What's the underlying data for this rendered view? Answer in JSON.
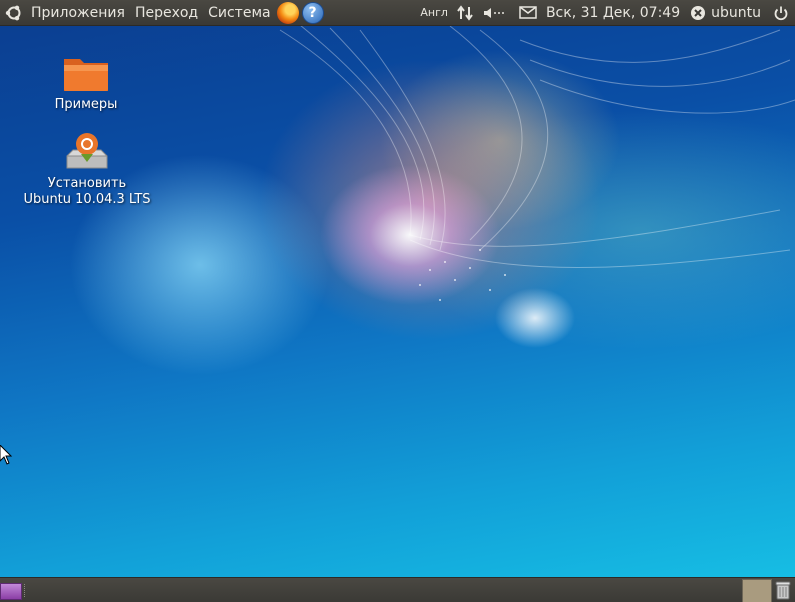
{
  "top_panel": {
    "menus": {
      "applications": "Приложения",
      "places": "Переход",
      "system": "Система"
    },
    "launchers": {
      "firefox": "firefox-icon",
      "help": "help-icon",
      "help_glyph": "?"
    },
    "keyboard_layout": "Англ",
    "network_icon": "network-arrows-icon",
    "volume_icon": "volume-icon",
    "mail_icon": "mail-icon",
    "clock": "Вск, 31 Дек, 07:49",
    "user_name": "ubuntu",
    "power_icon": "power-icon"
  },
  "desktop": {
    "icons": [
      {
        "label": "Примеры",
        "icon": "folder-icon"
      },
      {
        "label_line1": "Установить",
        "label_line2": "Ubuntu 10.04.3 LTS",
        "icon": "installer-icon"
      }
    ]
  },
  "bottom_panel": {
    "show_desktop_icon": "show-desktop-icon",
    "workspace_switcher": "workspace-switcher",
    "trash_icon": "trash-icon"
  },
  "colors": {
    "panel": "#3f3e3a",
    "panel_text": "#e8e6df",
    "desktop_top": "#0b3d8f",
    "desktop_bottom": "#17c3e6",
    "folder_orange": "#f07a2e"
  }
}
